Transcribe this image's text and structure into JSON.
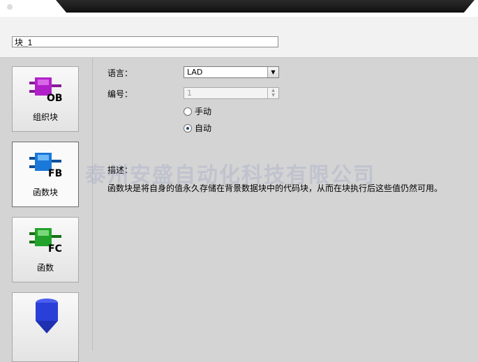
{
  "block_name": {
    "value": "块_1"
  },
  "block_types": [
    {
      "label": "组织块",
      "code": "OB",
      "color": "#b020c8"
    },
    {
      "label": "函数块",
      "code": "FB",
      "color": "#1a78d8"
    },
    {
      "label": "函数",
      "code": "FC",
      "color": "#22a22a"
    },
    {
      "label": "",
      "code": "",
      "color": "#2a3fd8"
    }
  ],
  "form": {
    "language_label": "语言：",
    "language_value": "LAD",
    "number_label": "编号：",
    "number_value": "1",
    "manual_label": "手动",
    "auto_label": "自动",
    "numbering_mode": "auto"
  },
  "description": {
    "label": "描述：",
    "text": "函数块是将自身的值永久存储在背景数据块中的代码块，从而在块执行后这些值仍然可用。"
  },
  "watermark": "泰州安盛自动化科技有限公司"
}
